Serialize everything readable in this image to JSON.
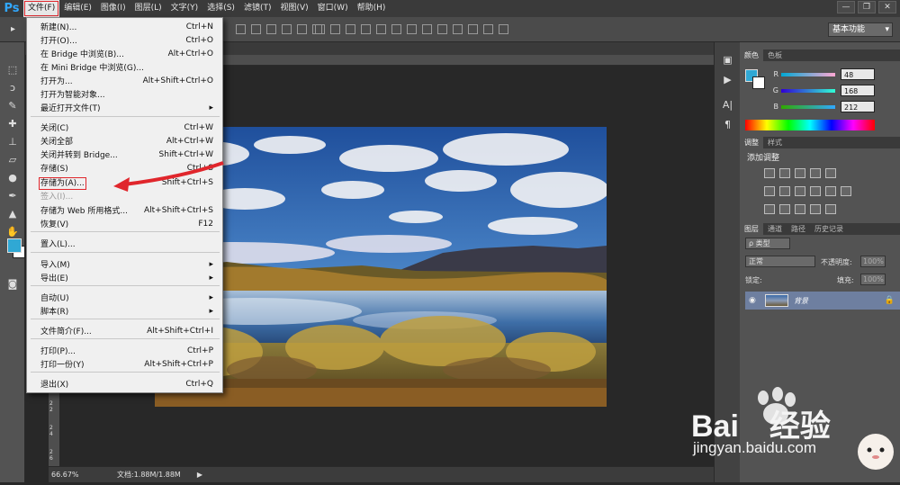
{
  "app": {
    "logo": "Ps"
  },
  "menubar": [
    "文件(F)",
    "编辑(E)",
    "图像(I)",
    "图层(L)",
    "文字(Y)",
    "选择(S)",
    "滤镜(T)",
    "视图(V)",
    "窗口(W)",
    "帮助(H)"
  ],
  "window_controls": [
    "—",
    "❐",
    "✕"
  ],
  "workspace": "基本功能",
  "file_menu": [
    {
      "label": "新建(N)...",
      "shortcut": "Ctrl+N"
    },
    {
      "label": "打开(O)...",
      "shortcut": "Ctrl+O"
    },
    {
      "label": "在 Bridge 中浏览(B)...",
      "shortcut": "Alt+Ctrl+O"
    },
    {
      "label": "在 Mini Bridge 中浏览(G)...",
      "shortcut": ""
    },
    {
      "label": "打开为...",
      "shortcut": "Alt+Shift+Ctrl+O"
    },
    {
      "label": "打开为智能对象...",
      "shortcut": ""
    },
    {
      "label": "最近打开文件(T)",
      "shortcut": "▸"
    },
    {
      "label": "关闭(C)",
      "shortcut": "Ctrl+W"
    },
    {
      "label": "关闭全部",
      "shortcut": "Alt+Ctrl+W"
    },
    {
      "label": "关闭并转到 Bridge...",
      "shortcut": "Shift+Ctrl+W"
    },
    {
      "label": "存储(S)",
      "shortcut": "Ctrl+S"
    },
    {
      "label": "存储为(A)...",
      "shortcut": "Shift+Ctrl+S"
    },
    {
      "label": "签入(I)...",
      "shortcut": ""
    },
    {
      "label": "存储为 Web 所用格式...",
      "shortcut": "Alt+Shift+Ctrl+S"
    },
    {
      "label": "恢复(V)",
      "shortcut": "F12"
    },
    {
      "label": "置入(L)...",
      "shortcut": ""
    },
    {
      "label": "导入(M)",
      "shortcut": "▸"
    },
    {
      "label": "导出(E)",
      "shortcut": "▸"
    },
    {
      "label": "自动(U)",
      "shortcut": "▸"
    },
    {
      "label": "脚本(R)",
      "shortcut": "▸"
    },
    {
      "label": "文件简介(F)...",
      "shortcut": "Alt+Shift+Ctrl+I"
    },
    {
      "label": "打印(P)...",
      "shortcut": "Ctrl+P"
    },
    {
      "label": "打印一份(Y)",
      "shortcut": "Alt+Shift+Ctrl+P"
    },
    {
      "label": "退出(X)",
      "shortcut": "Ctrl+Q"
    }
  ],
  "status": {
    "zoom": "66.67%",
    "doc": "文档:1.88M/1.88M",
    "arrow": "▶"
  },
  "ruler_left": [
    "2",
    "2",
    "2",
    "4",
    "2",
    "6"
  ],
  "color_panel": {
    "tabs": [
      "颜色",
      "色板"
    ],
    "r_label": "R",
    "g_label": "G",
    "b_label": "B",
    "r": "48",
    "g": "168",
    "b": "212",
    "fg_color": "#30a8d4"
  },
  "adjust_panel": {
    "tabs": [
      "调整",
      "样式"
    ],
    "title": "添加调整"
  },
  "layers_panel": {
    "tabs": [
      "图层",
      "通道",
      "路径",
      "历史记录"
    ],
    "kind": "ρ 类型",
    "blend": "正常",
    "opacity_label": "不透明度:",
    "opacity": "100%",
    "lock_label": "锁定:",
    "fill_label": "填充:",
    "fill": "100%",
    "layer_name": "背景"
  },
  "watermark": {
    "brand": "Bai",
    "brand2": "经验",
    "url": "jingyan.baidu.com"
  }
}
